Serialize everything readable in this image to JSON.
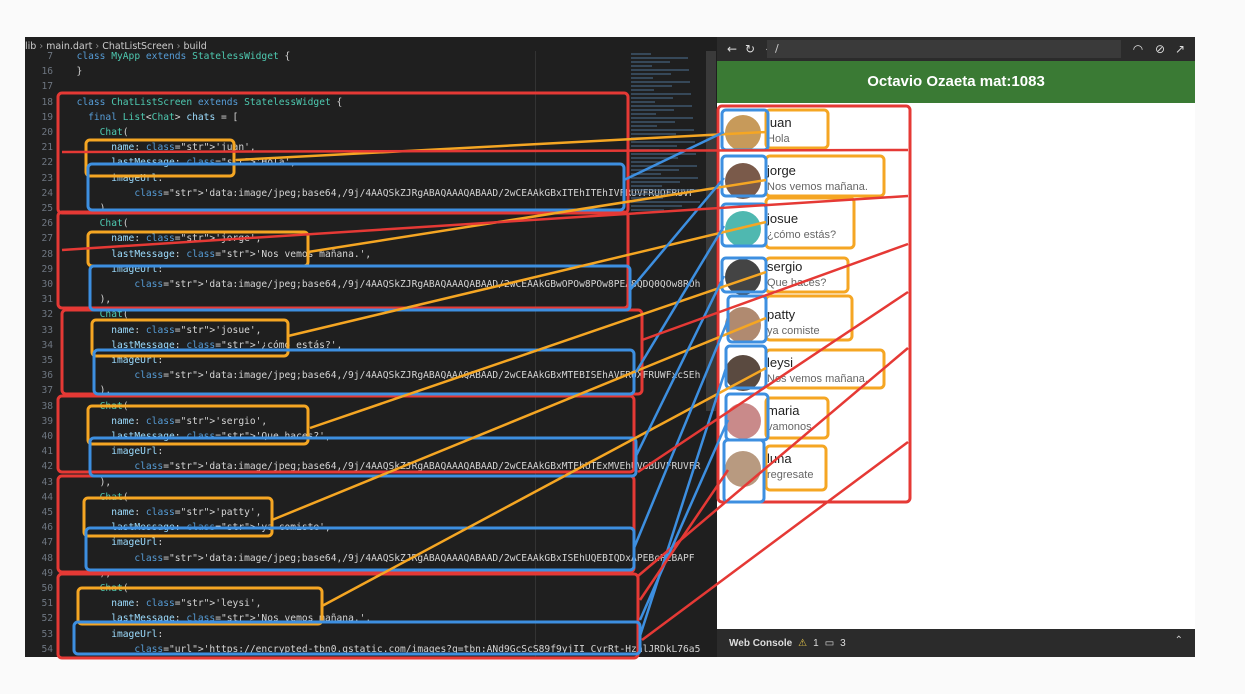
{
  "breadcrumb": [
    "lib",
    "main.dart",
    "ChatListScreen",
    "build"
  ],
  "code_lines": [
    {
      "n": "7",
      "t": "  class MyApp extends StatelessWidget {"
    },
    {
      "n": "16",
      "t": "  }"
    },
    {
      "n": "17",
      "t": ""
    },
    {
      "n": "18",
      "t": "  class ChatListScreen extends StatelessWidget {"
    },
    {
      "n": "19",
      "t": "    final List<Chat> chats = ["
    },
    {
      "n": "20",
      "t": "      Chat("
    },
    {
      "n": "21",
      "t": "        name: 'juan',"
    },
    {
      "n": "22",
      "t": "        lastMessage: 'Hola',"
    },
    {
      "n": "23",
      "t": "        imageUrl:"
    },
    {
      "n": "24",
      "t": "            'data:image/jpeg;base64,/9j/4AAQSkZJRgABAQAAAQABAAD/2wCEAAkGBxITEhITEhIVFRUVFRUQFRUVF"
    },
    {
      "n": "25",
      "t": "      ),"
    },
    {
      "n": "26",
      "t": "      Chat("
    },
    {
      "n": "27",
      "t": "        name: 'jorge',"
    },
    {
      "n": "28",
      "t": "        lastMessage: 'Nos vemos mañana.',"
    },
    {
      "n": "29",
      "t": "        imageUrl:"
    },
    {
      "n": "30",
      "t": "            'data:image/jpeg;base64,/9j/4AAQSkZJRgABAQAAAQABAAD/2wCEAAkGBwOPOw8POw8PEA8QDQ0QOw8ROh"
    },
    {
      "n": "31",
      "t": "      ),"
    },
    {
      "n": "32",
      "t": "      Chat("
    },
    {
      "n": "33",
      "t": "        name: 'josue',"
    },
    {
      "n": "34",
      "t": "        lastMessage: '¿cómo estás?',"
    },
    {
      "n": "35",
      "t": "        imageUrl:"
    },
    {
      "n": "36",
      "t": "            'data:image/jpeg;base64,/9j/4AAQSkZJRgABAQAAAQABAAD/2wCEAAkGBxMTEBISEhAVFRUXFRUWFxcSEh"
    },
    {
      "n": "37",
      "t": "      ),"
    },
    {
      "n": "38",
      "t": "      Chat("
    },
    {
      "n": "39",
      "t": "        name: 'sergio',"
    },
    {
      "n": "40",
      "t": "        lastMessage: 'Que haces?',"
    },
    {
      "n": "41",
      "t": "        imageUrl:"
    },
    {
      "n": "42",
      "t": "            'data:image/jpeg;base64,/9j/4AAQSkZJRgABAQAAAQABAAD/2wCEAAkGBxMTEhUTExMVEhUVGBUVFRUVFR"
    },
    {
      "n": "43",
      "t": "      ),"
    },
    {
      "n": "44",
      "t": "      Chat("
    },
    {
      "n": "45",
      "t": "        name: 'patty',"
    },
    {
      "n": "46",
      "t": "        lastMessage: 'ya comiste',"
    },
    {
      "n": "47",
      "t": "        imageUrl:"
    },
    {
      "n": "48",
      "t": "            'data:image/jpeg;base64,/9j/4AAQSkZJRgABAQAAAQABAAD/2wCEAAkGBxISEhUQEBIQDxAPEBcPEBAPF"
    },
    {
      "n": "49",
      "t": "      ),"
    },
    {
      "n": "50",
      "t": "      Chat("
    },
    {
      "n": "51",
      "t": "        name: 'leysi',"
    },
    {
      "n": "52",
      "t": "        lastMessage: 'Nos vemos mañana.',"
    },
    {
      "n": "53",
      "t": "        imageUrl:"
    },
    {
      "n": "54",
      "t": "            'https://encrypted-tbn0.gstatic.com/images?q=tbn:ANd9GcScS89f9yjII_CvrRt-HzalJRDkL76a5"
    }
  ],
  "preview": {
    "url": "/",
    "title": "Octavio Ozaeta mat:1083",
    "chats": [
      {
        "name": "juan",
        "message": "Hola",
        "avatar_color": "#c79a5a"
      },
      {
        "name": "jorge",
        "message": "Nos vemos mañana.",
        "avatar_color": "#7a5a4a"
      },
      {
        "name": "josue",
        "message": "¿cómo estás?",
        "avatar_color": "#4fb8b0"
      },
      {
        "name": "sergio",
        "message": "Que haces?",
        "avatar_color": "#444444"
      },
      {
        "name": "patty",
        "message": "ya comiste",
        "avatar_color": "#b08a70"
      },
      {
        "name": "leysi",
        "message": "Nos vemos mañana.",
        "avatar_color": "#5a4a40"
      },
      {
        "name": "maria",
        "message": "vamonos",
        "avatar_color": "#c98a8a"
      },
      {
        "name": "luna",
        "message": "regresate",
        "avatar_color": "#b89a80"
      }
    ],
    "console_label": "Web Console",
    "warnings": "1",
    "messages": "3"
  },
  "colors": {
    "red": "#e53935",
    "orange": "#f5a623",
    "blue": "#3d8fe0",
    "appbar": "#3a7a34"
  }
}
